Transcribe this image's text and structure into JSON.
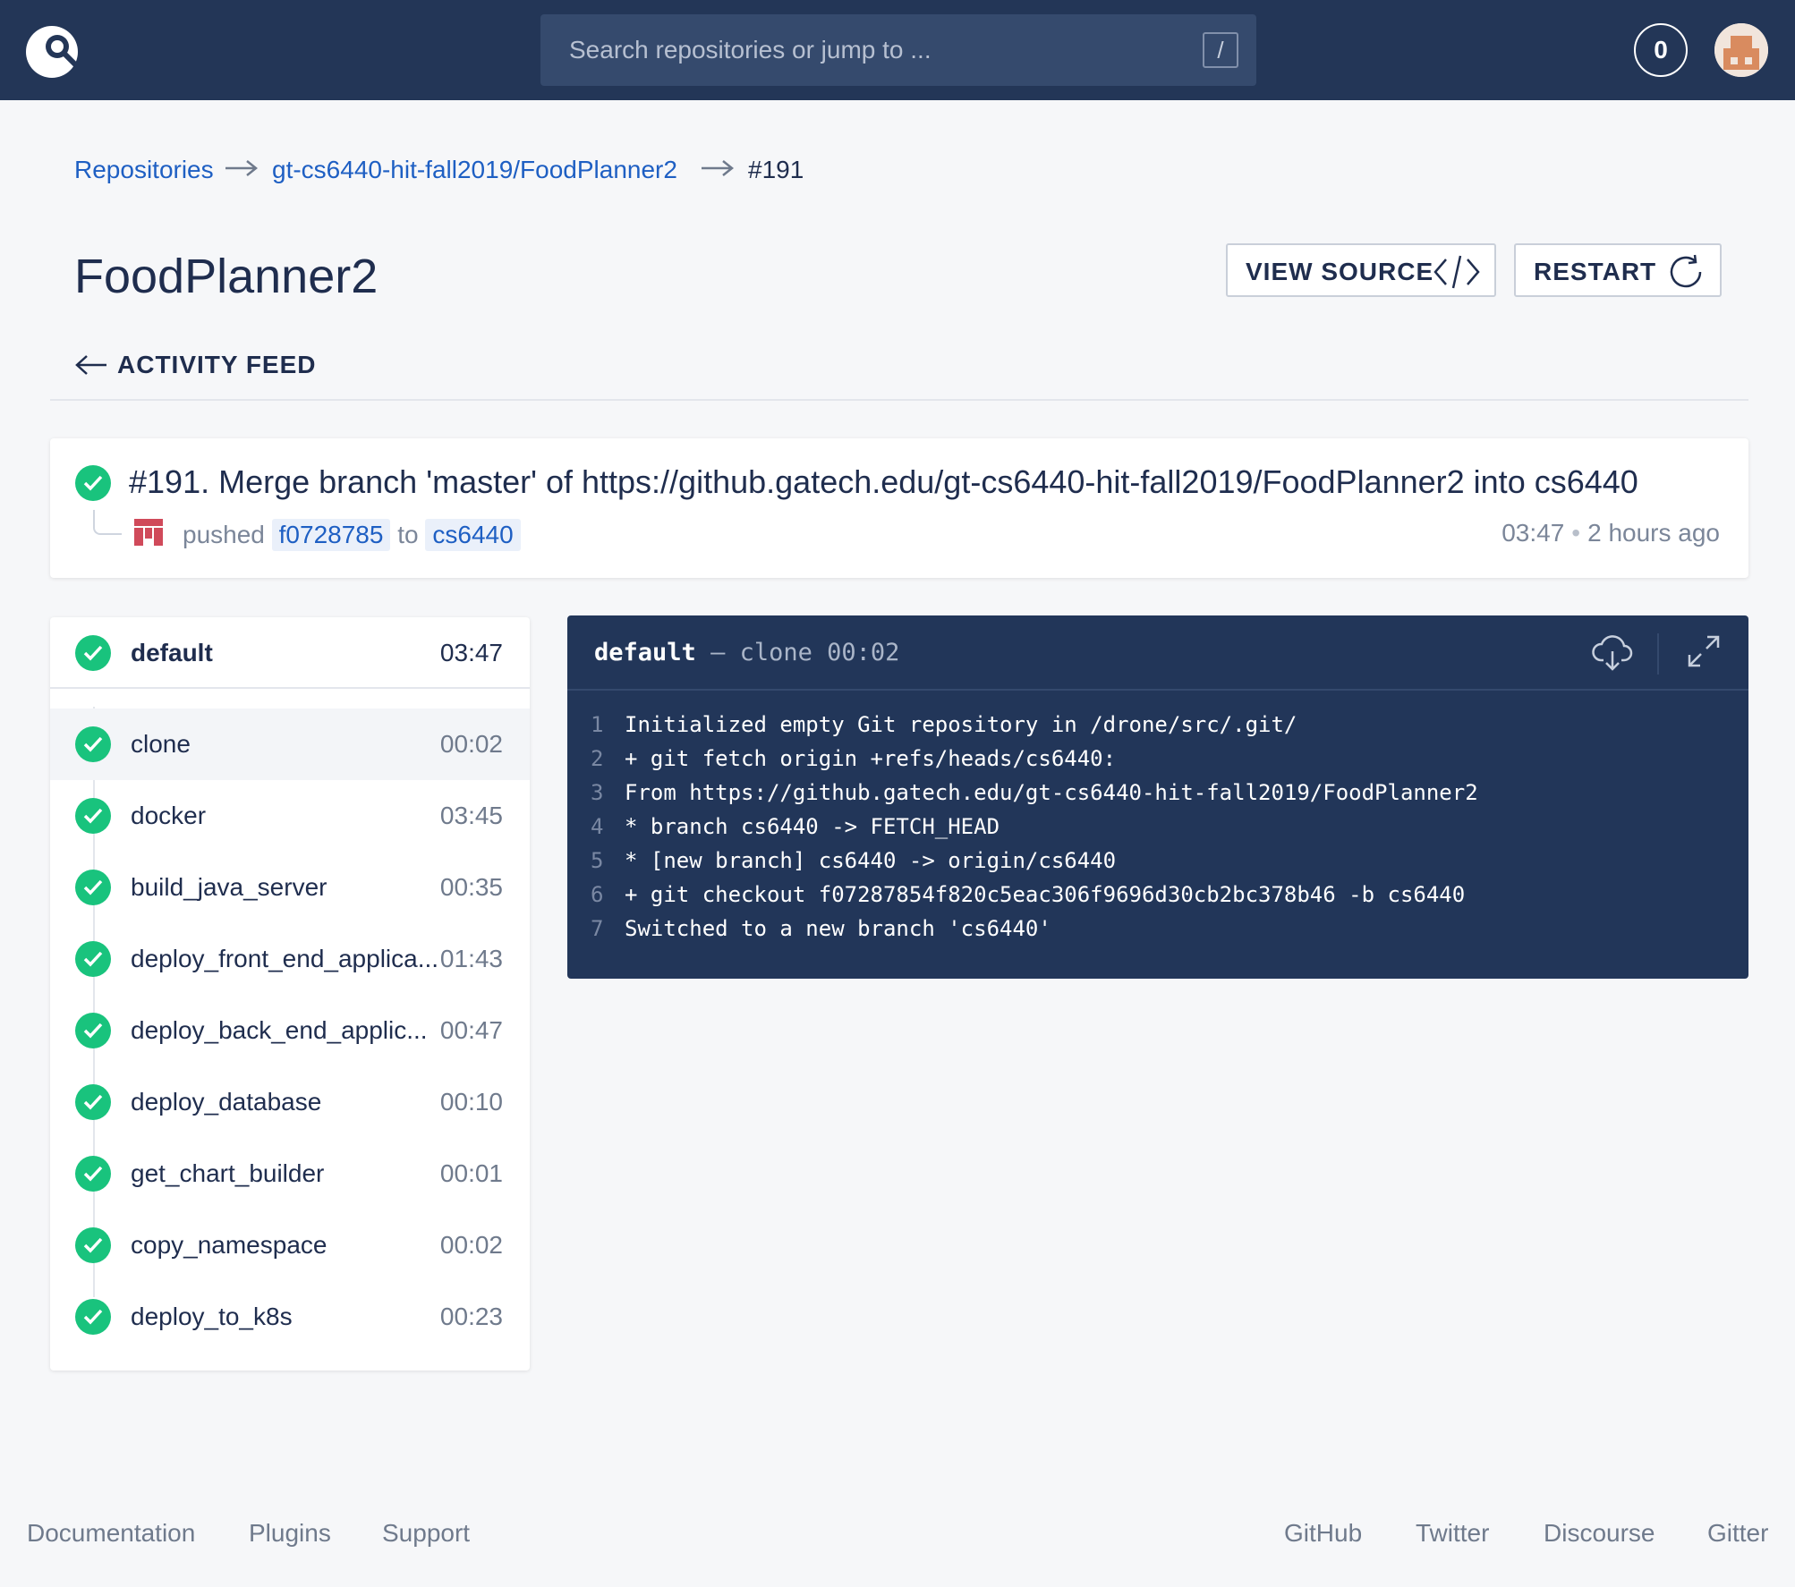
{
  "header": {
    "logo": "drone-logo-icon",
    "search_placeholder": "Search repositories or jump to ...",
    "shortcut_key": "/",
    "notification_count": "0",
    "avatar": "user-avatar"
  },
  "breadcrumb": {
    "root": "Repositories",
    "repo": "gt-cs6440-hit-fall2019/FoodPlanner2",
    "current": "#191"
  },
  "repo_title": "FoodPlanner2",
  "actions": {
    "view_source": "VIEW SOURCE",
    "restart": "RESTART"
  },
  "activity_link": "ACTIVITY FEED",
  "commit": {
    "message": "#191. Merge branch 'master' of https://github.gatech.edu/gt-cs6440-hit-fall2019/FoodPlanner2 into cs6440",
    "action_word": "pushed",
    "sha": "f0728785",
    "to_word": "to",
    "branch": "cs6440",
    "duration": "03:47",
    "age": "2 hours ago"
  },
  "stage": {
    "name": "default",
    "duration": "03:47"
  },
  "steps": [
    {
      "name": "clone",
      "duration": "00:02"
    },
    {
      "name": "docker",
      "duration": "03:45"
    },
    {
      "name": "build_java_server",
      "duration": "00:35"
    },
    {
      "name": "deploy_front_end_applica...",
      "duration": "01:43"
    },
    {
      "name": "deploy_back_end_applic...",
      "duration": "00:47"
    },
    {
      "name": "deploy_database",
      "duration": "00:10"
    },
    {
      "name": "get_chart_builder",
      "duration": "00:01"
    },
    {
      "name": "copy_namespace",
      "duration": "00:02"
    },
    {
      "name": "deploy_to_k8s",
      "duration": "00:23"
    }
  ],
  "log": {
    "stage": "default",
    "dash": "—",
    "step": "clone",
    "duration": "00:02",
    "lines": [
      {
        "n": "1",
        "text": "Initialized empty Git repository in /drone/src/.git/"
      },
      {
        "n": "2",
        "text": "+ git fetch origin +refs/heads/cs6440:"
      },
      {
        "n": "3",
        "text": "From https://github.gatech.edu/gt-cs6440-hit-fall2019/FoodPlanner2"
      },
      {
        "n": "4",
        "text": "* branch cs6440 -> FETCH_HEAD"
      },
      {
        "n": "5",
        "text": "* [new branch] cs6440 -> origin/cs6440"
      },
      {
        "n": "6",
        "text": "+ git checkout f07287854f820c5eac306f9696d30cb2bc378b46 -b cs6440"
      },
      {
        "n": "7",
        "text": "Switched to a new branch 'cs6440'"
      }
    ]
  },
  "footer": {
    "left": [
      "Documentation",
      "Plugins",
      "Support"
    ],
    "right": [
      "GitHub",
      "Twitter",
      "Discourse",
      "Gitter"
    ]
  },
  "colors": {
    "header_bg": "#233657",
    "link": "#1e5fc3",
    "success": "#19c37d",
    "log_bg": "#223659"
  }
}
